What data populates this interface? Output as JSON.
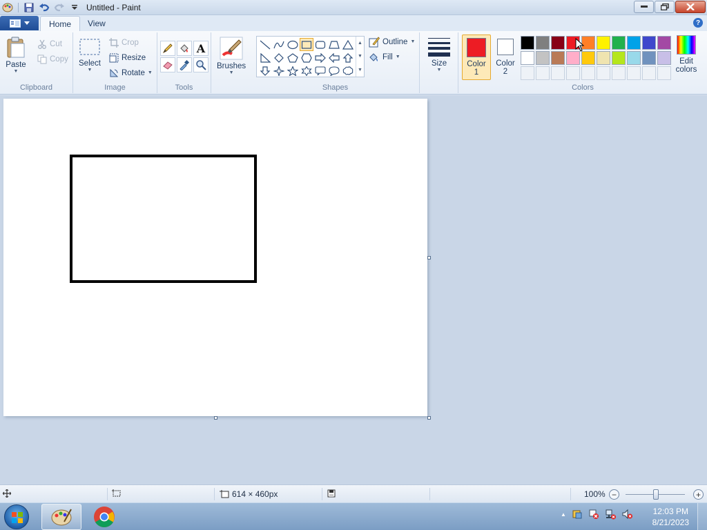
{
  "window": {
    "title": "Untitled - Paint"
  },
  "tabs": {
    "home": "Home",
    "view": "View"
  },
  "clipboard": {
    "paste": "Paste",
    "cut": "Cut",
    "copy": "Copy",
    "group_label": "Clipboard"
  },
  "image": {
    "select": "Select",
    "crop": "Crop",
    "resize": "Resize",
    "rotate": "Rotate",
    "group_label": "Image"
  },
  "tools": {
    "group_label": "Tools",
    "items": [
      "pencil-icon",
      "fill-icon",
      "text-icon",
      "eraser-icon",
      "color-picker-icon",
      "magnifier-icon"
    ]
  },
  "brushes": {
    "label": "Brushes"
  },
  "shapes": {
    "group_label": "Shapes",
    "outline": "Outline",
    "fill": "Fill",
    "selected": "rectangle"
  },
  "size": {
    "label": "Size"
  },
  "colors": {
    "group_label": "Colors",
    "color1_line1": "Color",
    "color1_line2": "1",
    "color2_line1": "Color",
    "color2_line2": "2",
    "color1_value": "#ed1c24",
    "color2_value": "#ffffff",
    "edit_line1": "Edit",
    "edit_line2": "colors",
    "palette_row1": [
      "#000000",
      "#7f7f7f",
      "#880015",
      "#ed1c24",
      "#ff7f27",
      "#fff200",
      "#22b14c",
      "#00a2e8",
      "#3f48cc",
      "#a349a4"
    ],
    "palette_row2": [
      "#ffffff",
      "#c3c3c3",
      "#b97a57",
      "#ffaec9",
      "#ffc90e",
      "#efe4b0",
      "#b5e61d",
      "#99d9ea",
      "#7092be",
      "#c8bfe7"
    ]
  },
  "status": {
    "dimensions": "614 × 460px",
    "zoom": "100%"
  },
  "taskbar": {
    "time": "12:03 PM",
    "date": "8/21/2023"
  }
}
